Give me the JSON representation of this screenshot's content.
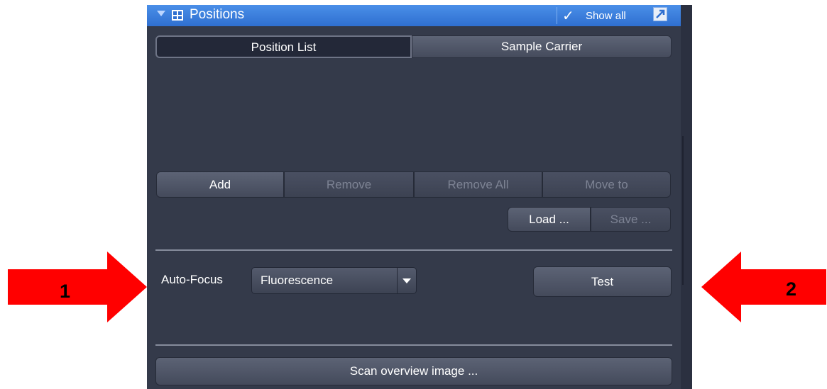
{
  "header": {
    "title": "Positions",
    "show_all_check": "✓",
    "show_all_label": "Show all",
    "collapse_icon": "triangle-down-icon",
    "panel_icon": "positions-grid-icon",
    "external_icon": "external-window-icon"
  },
  "tabs": [
    {
      "label": "Position List",
      "active": true
    },
    {
      "label": "Sample Carrier",
      "active": false
    }
  ],
  "list_buttons": {
    "add": "Add",
    "remove": "Remove",
    "remove_all": "Remove All",
    "move_to": "Move to"
  },
  "file_buttons": {
    "load": "Load ...",
    "save": "Save ..."
  },
  "autofocus": {
    "label": "Auto-Focus",
    "selected": "Fluorescence",
    "test_label": "Test"
  },
  "scan_button": "Scan overview image ...",
  "callouts": [
    {
      "number": "1",
      "color": "#ff0000"
    },
    {
      "number": "2",
      "color": "#ff0000"
    }
  ],
  "colors": {
    "panel_bg": "#343a4a",
    "header_blue": "#3b7ddb",
    "arrow_red": "#ff0000"
  }
}
